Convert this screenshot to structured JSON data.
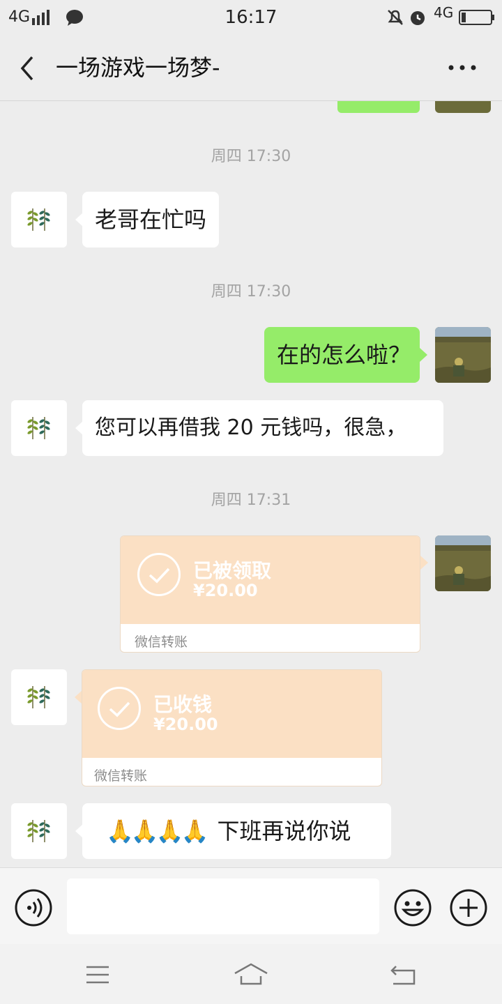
{
  "status_bar": {
    "network": "4G",
    "time": "16:17",
    "network_right": "4G"
  },
  "header": {
    "title": "一场游戏一场梦-"
  },
  "messages": {
    "ts1": "周四 17:30",
    "m1": "老哥在忙吗",
    "ts2": "周四 17:30",
    "m2": "在的怎么啦？",
    "m3": "您可以再借我 20 元钱吗，很急，",
    "ts3": "周四 17:31",
    "transfer1": {
      "status": "已被领取",
      "amount": "¥20.00",
      "footer": "微信转账"
    },
    "transfer2": {
      "status": "已收钱",
      "amount": "¥20.00",
      "footer": "微信转账"
    },
    "m4_emoji": "🙏🙏🙏🙏",
    "m4_text": "下班再说你说"
  },
  "colors": {
    "background": "#ededed",
    "sent_bubble": "#95ec69",
    "received_bubble": "#ffffff",
    "transfer": "#fbe0c4"
  },
  "icons": [
    "back-icon",
    "more-icon",
    "voice-icon",
    "emoji-icon",
    "add-icon",
    "menu-icon",
    "home-icon",
    "back-nav-icon"
  ]
}
